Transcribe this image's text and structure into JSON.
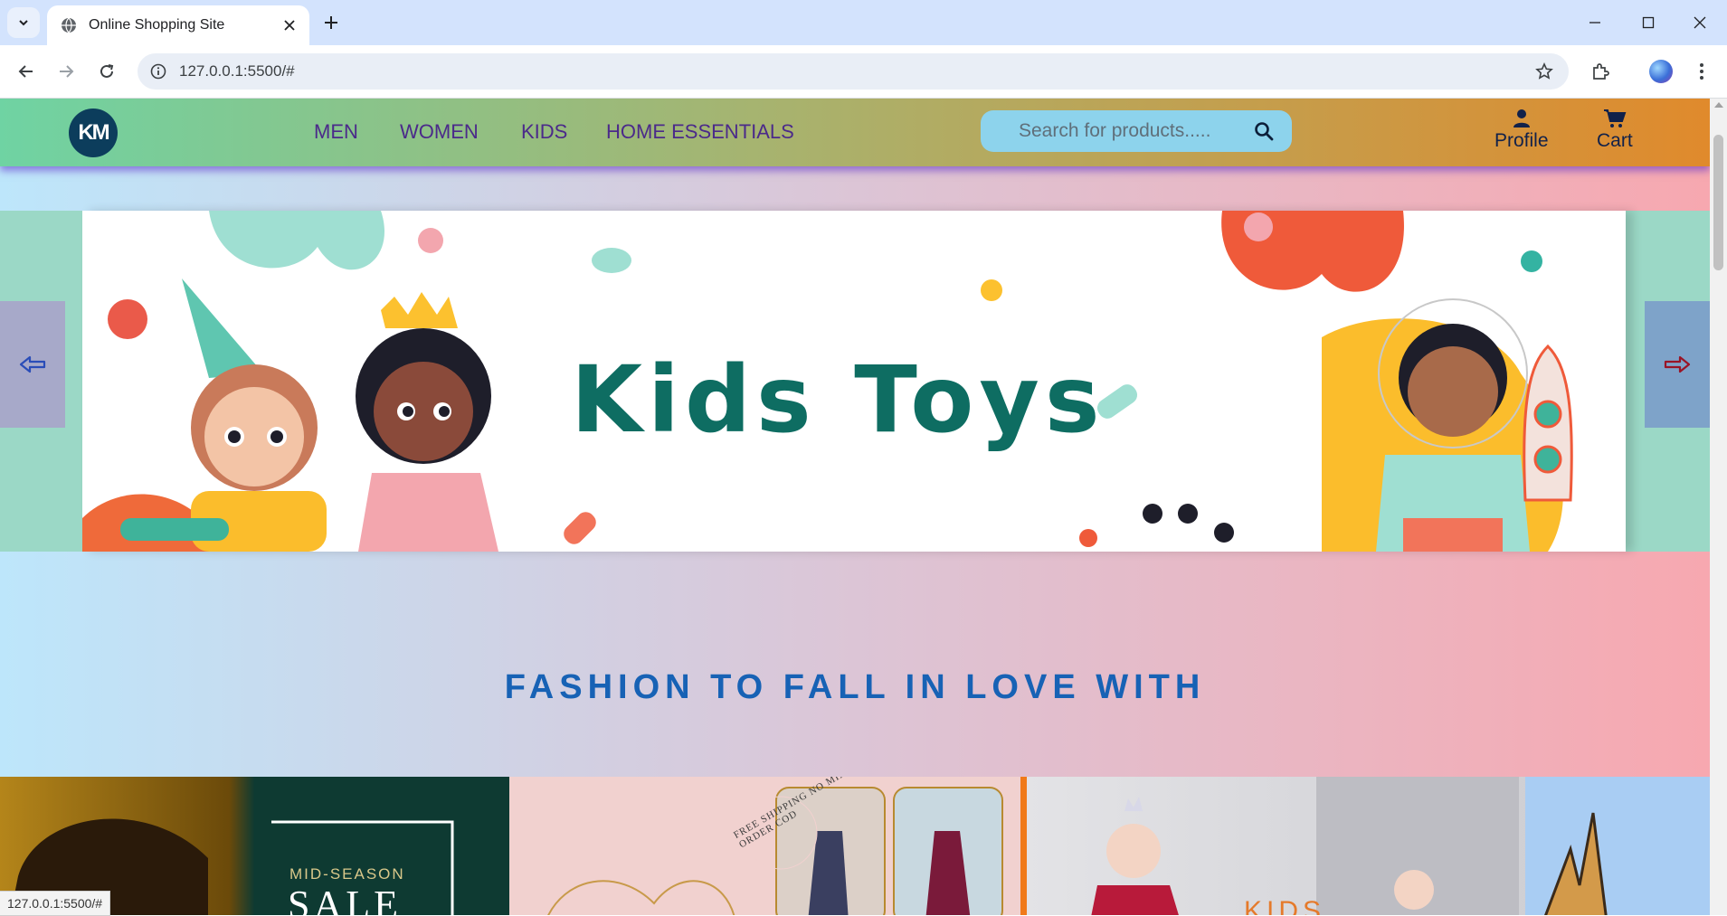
{
  "browser": {
    "tab_title": "Online Shopping Site",
    "url": "127.0.0.1:5500/#",
    "status_url": "127.0.0.1:5500/#"
  },
  "site": {
    "logo_text": "KM",
    "nav": [
      "MEN",
      "WOMEN",
      "KIDS",
      "HOME ESSENTIALS"
    ],
    "search_placeholder": "Search for products.....",
    "profile_label": "Profile",
    "cart_label": "Cart"
  },
  "carousel": {
    "slide_title": "Kids Toys",
    "prev_icon": "left-arrow-icon",
    "next_icon": "right-arrow-icon"
  },
  "section": {
    "title": "FASHION TO FALL IN LOVE WITH"
  },
  "promos": {
    "sale_top": "MID-SEASON",
    "sale_big": "SALE",
    "ring_text": "FREE SHIPPING NO MIN ORDER COD",
    "kids_word": "KIDS"
  },
  "colors": {
    "header_start": "#6fd3a3",
    "header_end": "#e08a2c",
    "nav_text": "#4b2a8a",
    "section_title": "#1762b5",
    "slide_title": "#0e6d62"
  }
}
